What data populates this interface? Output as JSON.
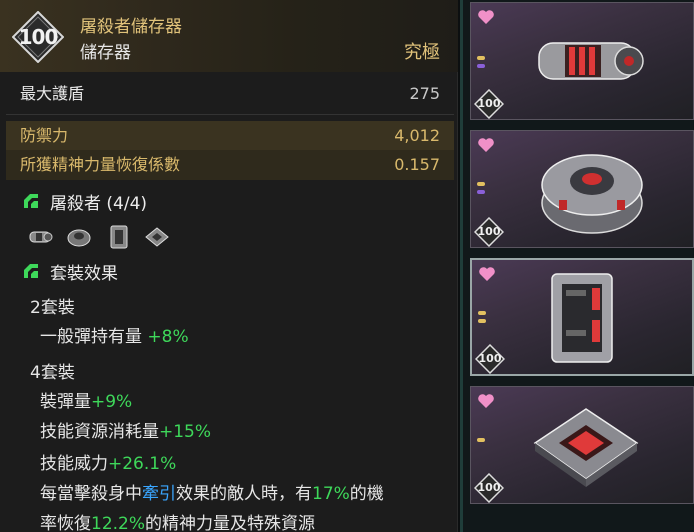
{
  "tooltip": {
    "level": "100",
    "name": "屠殺者儲存器",
    "type": "儲存器",
    "rarity": "究極",
    "stats": [
      {
        "label": "最大護盾",
        "value": "275"
      },
      {
        "label": "防禦力",
        "value": "4,012"
      },
      {
        "label": "所獲精神力量恢復係數",
        "value": "0.157"
      }
    ],
    "set_name": "屠殺者 (4/4)",
    "set_effect_title": "套裝效果",
    "set2": {
      "title": "2套裝",
      "line1_label": "一般彈持有量 ",
      "line1_value": "+8%"
    },
    "set4": {
      "title": "4套裝",
      "line1_label": "裝彈量",
      "line1_value": "+9%",
      "line2_label": "技能資源消耗量",
      "line2_value": "+15%",
      "line3_label": "技能威力",
      "line3_value": "+26.1%",
      "line4_a": "每當擊殺身中",
      "line4_b": "牽引",
      "line4_c": "效果的敵人時，有",
      "line4_d": "17%",
      "line4_e": "的機",
      "line5_a": "率恢復",
      "line5_b": "12.2%",
      "line5_c": "的精神力量及特殊資源"
    },
    "set_piece_icons": [
      "cylinder-part-icon",
      "ring-part-icon",
      "block-part-icon",
      "square-part-icon"
    ]
  },
  "cards": [
    {
      "level": "100",
      "art": "cylinder-module",
      "selected": false
    },
    {
      "level": "100",
      "art": "ring-module",
      "selected": false
    },
    {
      "level": "100",
      "art": "block-module",
      "selected": true
    },
    {
      "level": "100",
      "art": "square-module",
      "selected": false
    }
  ],
  "colors": {
    "gold": "#e0c27a",
    "highlight_green": "#3ed85a",
    "keyword_blue": "#3aa6ff",
    "favorite_pink": "#f090c8"
  }
}
